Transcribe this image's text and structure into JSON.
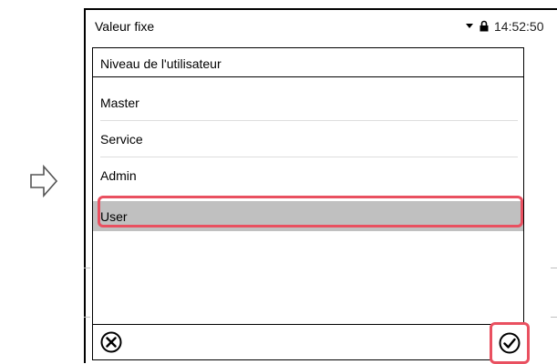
{
  "status_bar": {
    "title": "Valeur fixe",
    "time": "14:52:50",
    "icons": [
      "dropdown-arrow-icon",
      "lock-icon"
    ]
  },
  "panel": {
    "title": "Niveau de l'utilisateur",
    "items": [
      {
        "label": "Master",
        "selected": false
      },
      {
        "label": "Service",
        "selected": false
      },
      {
        "label": "Admin",
        "selected": false
      },
      {
        "label": "User",
        "selected": true
      }
    ]
  },
  "buttons": {
    "cancel_icon": "cancel-icon",
    "confirm_icon": "confirm-check-icon"
  },
  "colors": {
    "highlight": "#e95060",
    "selected_row": "#c0c0c0"
  }
}
